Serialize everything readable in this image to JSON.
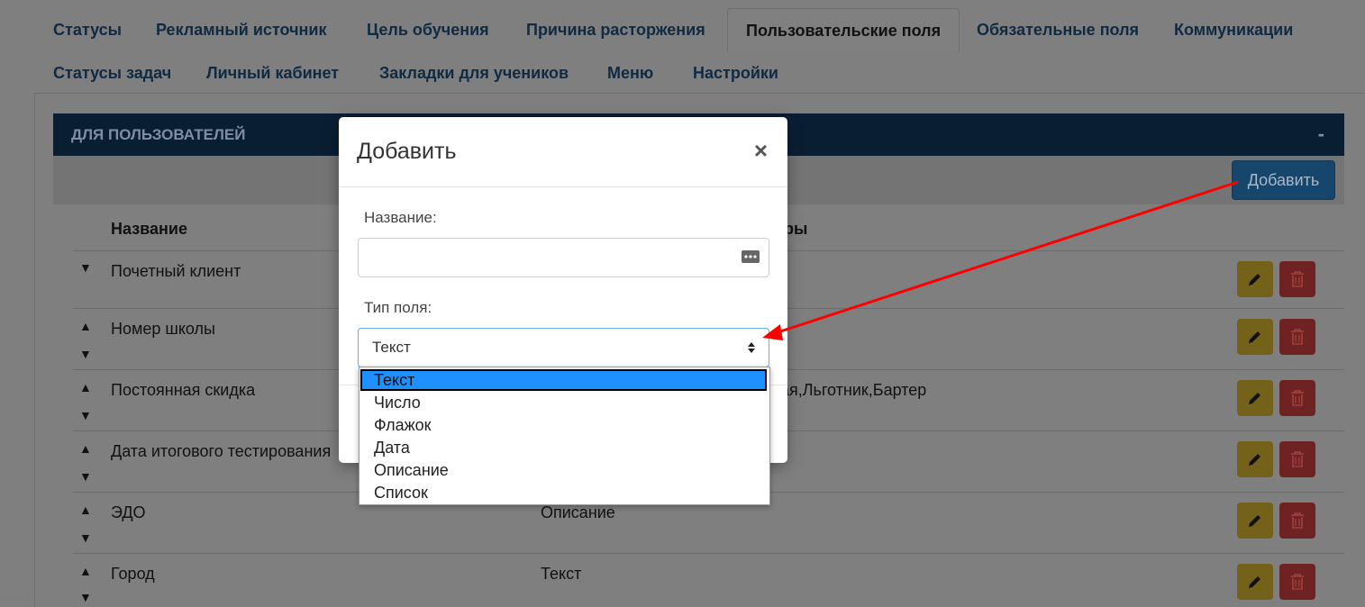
{
  "tabs_row1": [
    "Статусы",
    "Рекламный источник",
    "Цель обучения",
    "Причина расторжения",
    "Пользовательские поля",
    "Обязательные поля",
    "Коммуникации"
  ],
  "tabs_row2": [
    "Статусы задач",
    "Личный кабинет",
    "Закладки для учеников",
    "Меню",
    "Настройки"
  ],
  "active_tab": "Пользовательские поля",
  "panel": {
    "title": "ДЛЯ ПОЛЬЗОВАТЕЛЕЙ",
    "collapse": "-"
  },
  "toolbar": {
    "add_label": "Добавить"
  },
  "table": {
    "col_name": "Название",
    "col_params_tail": "ры",
    "rows": [
      {
        "name": "Почетный клиент",
        "type": ""
      },
      {
        "name": "Номер школы",
        "type": ""
      },
      {
        "name": "Постоянная скидка",
        "type": "ная,Льготник,Бартер"
      },
      {
        "name": "Дата итогового тестирования",
        "type": ""
      },
      {
        "name": "ЭДО",
        "type": "Описание"
      },
      {
        "name": "Город",
        "type": "Текст"
      }
    ]
  },
  "modal": {
    "title": "Добавить",
    "close": "×",
    "name_label": "Название:",
    "name_value": "",
    "type_label": "Тип поля:",
    "type_value": "Текст",
    "options": [
      "Текст",
      "Число",
      "Флажок",
      "Дата",
      "Описание",
      "Список"
    ],
    "selected_option": "Текст"
  },
  "colors": {
    "annotation_arrow": "#ff0000",
    "header_bg": "#0a1e33",
    "selected_option": "#1e90ff"
  }
}
